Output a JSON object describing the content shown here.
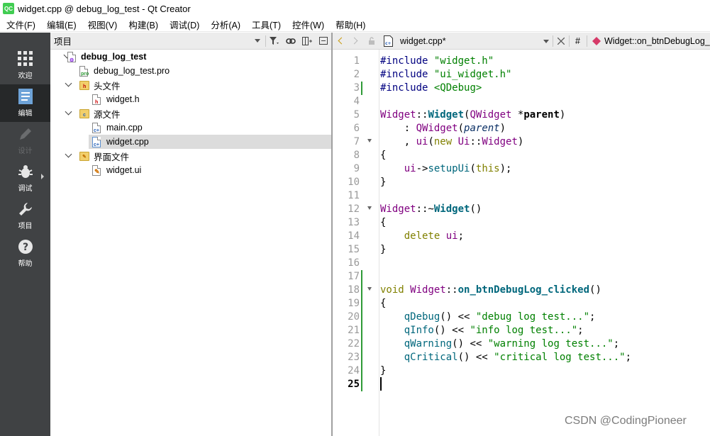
{
  "window": {
    "app_icon": "QC",
    "title": "widget.cpp @ debug_log_test - Qt Creator"
  },
  "menu": [
    "文件(F)",
    "编辑(E)",
    "视图(V)",
    "构建(B)",
    "调试(D)",
    "分析(A)",
    "工具(T)",
    "控件(W)",
    "帮助(H)"
  ],
  "modes": [
    {
      "label": "欢迎",
      "icon": "grid-icon",
      "state": "normal"
    },
    {
      "label": "编辑",
      "icon": "edit-doc-icon",
      "state": "active"
    },
    {
      "label": "设计",
      "icon": "pencil-icon",
      "state": "disabled"
    },
    {
      "label": "调试",
      "icon": "bug-icon",
      "state": "normal"
    },
    {
      "label": "项目",
      "icon": "wrench-icon",
      "state": "normal"
    },
    {
      "label": "帮助",
      "icon": "help-icon",
      "state": "normal"
    }
  ],
  "project_panel": {
    "title": "项目",
    "tree": [
      {
        "label": "debug_log_test",
        "type": "project",
        "expanded": true
      },
      {
        "label": "debug_log_test.pro",
        "type": "pro-file"
      },
      {
        "label": "头文件",
        "type": "folder",
        "badge": "h",
        "expanded": true
      },
      {
        "label": "widget.h",
        "type": "header-file"
      },
      {
        "label": "源文件",
        "type": "folder",
        "badge": "c",
        "expanded": true
      },
      {
        "label": "main.cpp",
        "type": "cpp-file"
      },
      {
        "label": "widget.cpp",
        "type": "cpp-file",
        "selected": true
      },
      {
        "label": "界面文件",
        "type": "folder",
        "badge": "ui",
        "expanded": true
      },
      {
        "label": "widget.ui",
        "type": "ui-file"
      }
    ]
  },
  "editor": {
    "file_tab": "widget.cpp*",
    "hash_label": "#",
    "symbol": "Widget::on_btnDebugLog_clicked()",
    "line_numbers": [
      "1",
      "2",
      "3",
      "4",
      "5",
      "6",
      "7",
      "8",
      "9",
      "10",
      "11",
      "12",
      "13",
      "14",
      "15",
      "16",
      "17",
      "18",
      "19",
      "20",
      "21",
      "22",
      "23",
      "24",
      "25"
    ],
    "current_line": "25"
  },
  "code": {
    "l1": {
      "directive": "#include",
      "file": "\"widget.h\""
    },
    "l2": {
      "directive": "#include",
      "file": "\"ui_widget.h\""
    },
    "l3": {
      "directive": "#include",
      "file": "<QDebug>"
    },
    "l5": {
      "cls": "Widget",
      "sep": "::",
      "fn": "Widget",
      "open": "(",
      "type": "QWidget",
      "ptr": " *",
      "param": "parent",
      "close": ")"
    },
    "l6": {
      "indent": "    : ",
      "base": "QWidget",
      "open": "(",
      "param": "parent",
      "close": ")"
    },
    "l7": {
      "indent": "    , ",
      "member": "ui",
      "open": "(",
      "kw": "new",
      "sp": " ",
      "ns": "Ui",
      "sep": "::",
      "cls": "Widget",
      "close": ")"
    },
    "l8": "{",
    "l9": {
      "indent": "    ",
      "member": "ui",
      "arrow": "->",
      "fn": "setupUi",
      "open": "(",
      "kw": "this",
      "close": ");"
    },
    "l10": "}",
    "l12": {
      "cls": "Widget",
      "sep": "::~",
      "fn": "Widget",
      "rest": "()"
    },
    "l13": "{",
    "l14": {
      "indent": "    ",
      "kw": "delete",
      "sp": " ",
      "member": "ui",
      "end": ";"
    },
    "l15": "}",
    "l18": {
      "kw": "void",
      "sp": " ",
      "cls": "Widget",
      "sep": "::",
      "fn": "on_btnDebugLog_clicked",
      "rest": "()"
    },
    "l19": "{",
    "l20": {
      "indent": "    ",
      "fn": "qDebug",
      "call": "() << ",
      "str": "\"debug log test...\"",
      "end": ";"
    },
    "l21": {
      "indent": "    ",
      "fn": "qInfo",
      "call": "() << ",
      "str": "\"info log test...\"",
      "end": ";"
    },
    "l22": {
      "indent": "    ",
      "fn": "qWarning",
      "call": "() << ",
      "str": "\"warning log test...\"",
      "end": ";"
    },
    "l23": {
      "indent": "    ",
      "fn": "qCritical",
      "call": "() << ",
      "str": "\"critical log test...\"",
      "end": ";"
    },
    "l24": "}"
  },
  "watermark": "CSDN @CodingPioneer",
  "colors": {
    "modebar": "#404244",
    "modebar_active": "#262829",
    "keyword": "#808000",
    "string": "#008000",
    "class": "#800080",
    "function": "#00677c",
    "change_bar": "#2f9a37"
  }
}
